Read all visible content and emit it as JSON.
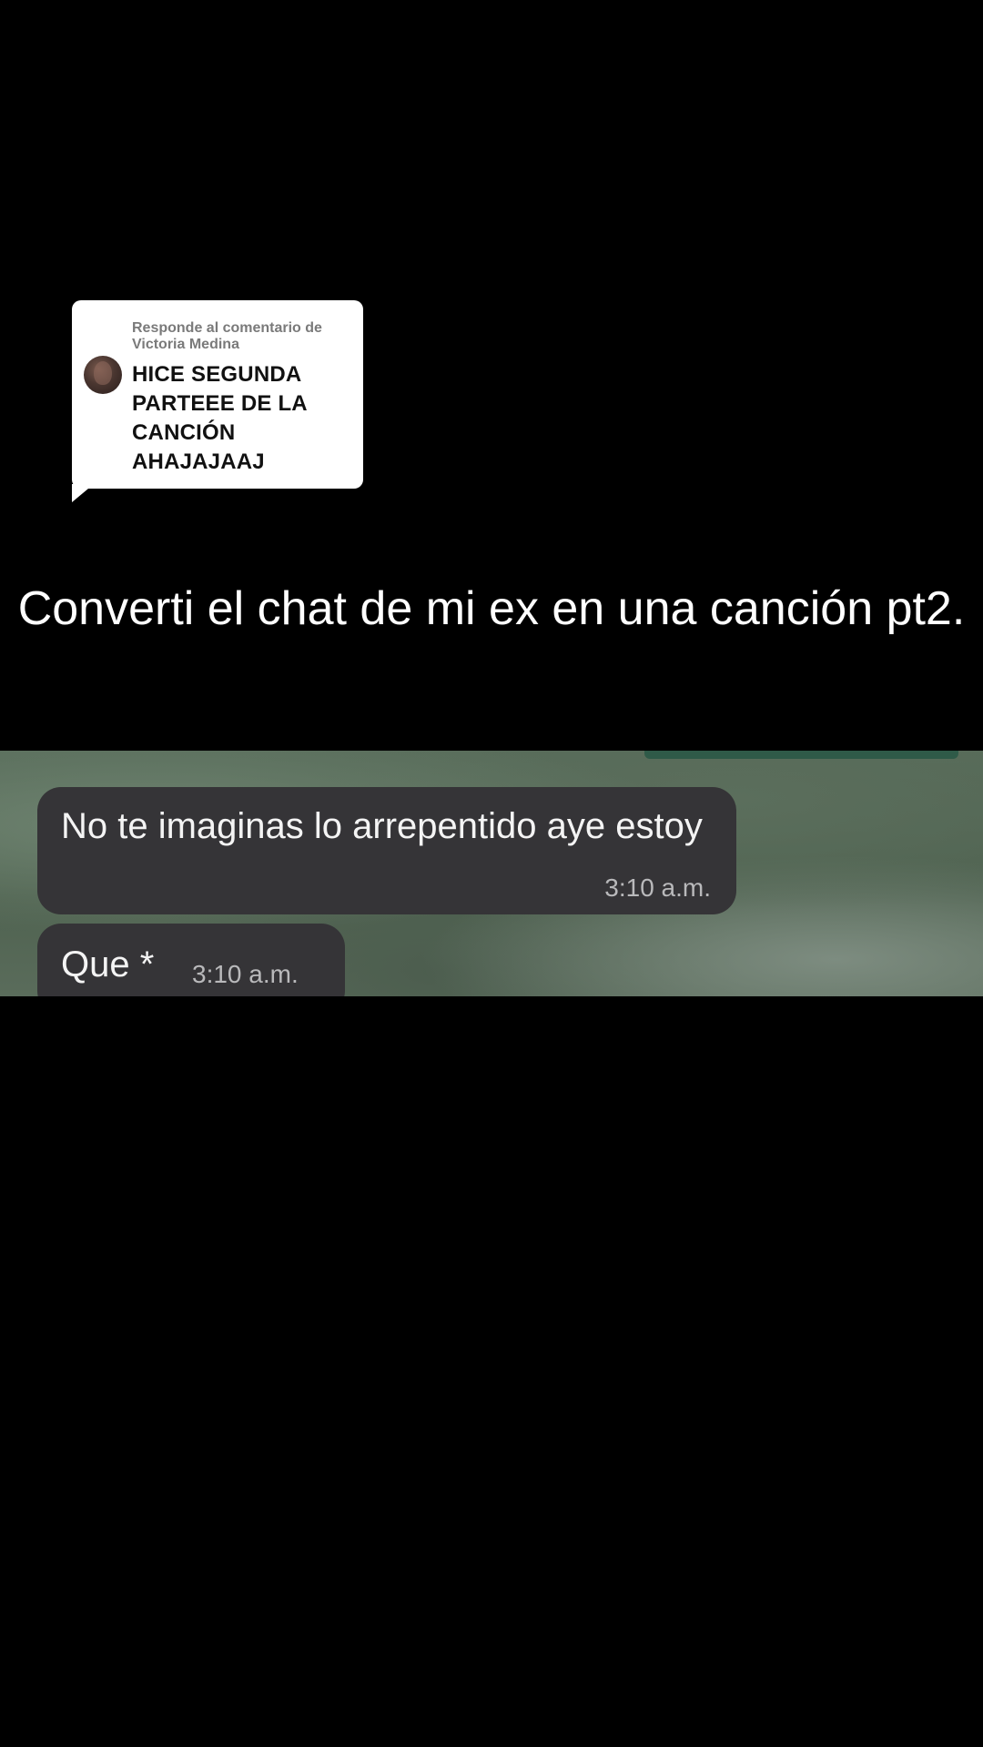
{
  "reply_card": {
    "header": "Responde al comentario de Victoria Medina",
    "comment": "HICE SEGUNDA PARTEEE DE LA CANCIÓN AHAJAJAAJ",
    "avatar_icon": "commenter-avatar"
  },
  "caption": "Converti el chat de mi ex en una canción pt2.",
  "chat": {
    "messages": [
      {
        "text": "No te imaginas lo arrepentido aye estoy",
        "time": "3:10 a.m."
      },
      {
        "text": "Que *",
        "time": "3:10 a.m."
      }
    ],
    "bubble_color": "#353437",
    "accent_green": "#2f5a48"
  }
}
